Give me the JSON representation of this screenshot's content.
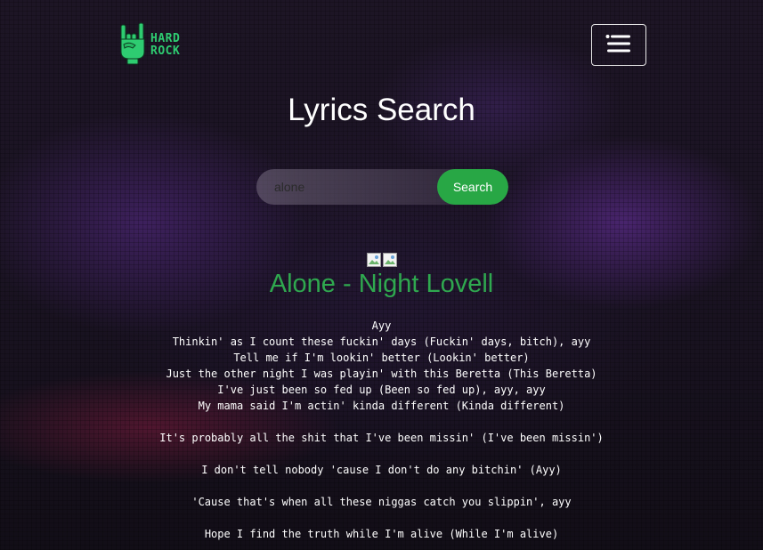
{
  "header": {
    "logo": {
      "line1": "HARD",
      "line2": "ROCK",
      "icon": "rock-hand-icon",
      "color": "#2ecc71"
    },
    "menu_icon": "hamburger-menu-icon"
  },
  "main": {
    "title": "Lyrics Search",
    "search": {
      "value": "alone",
      "button_label": "Search",
      "button_color": "#28a745"
    },
    "result": {
      "image_icons": [
        "broken-image-icon",
        "broken-image-icon"
      ],
      "song_title": "Alone - Night Lovell",
      "title_color": "#2fa84f",
      "lyrics": [
        "Ayy",
        "Thinkin' as I count these fuckin' days (Fuckin' days, bitch), ayy",
        "Tell me if I'm lookin' better (Lookin' better)",
        "Just the other night I was playin' with this Beretta (This Beretta)",
        "I've just been so fed up (Been so fed up), ayy, ayy",
        "My mama said I'm actin' kinda different (Kinda different)",
        "",
        "It's probably all the shit that I've been missin' (I've been missin')",
        "",
        "I don't tell nobody 'cause I don't do any bitchin' (Ayy)",
        "",
        "'Cause that's when all these niggas catch you slippin', ayy",
        "",
        "Hope I find the truth while I'm alive (While I'm alive)"
      ]
    }
  }
}
